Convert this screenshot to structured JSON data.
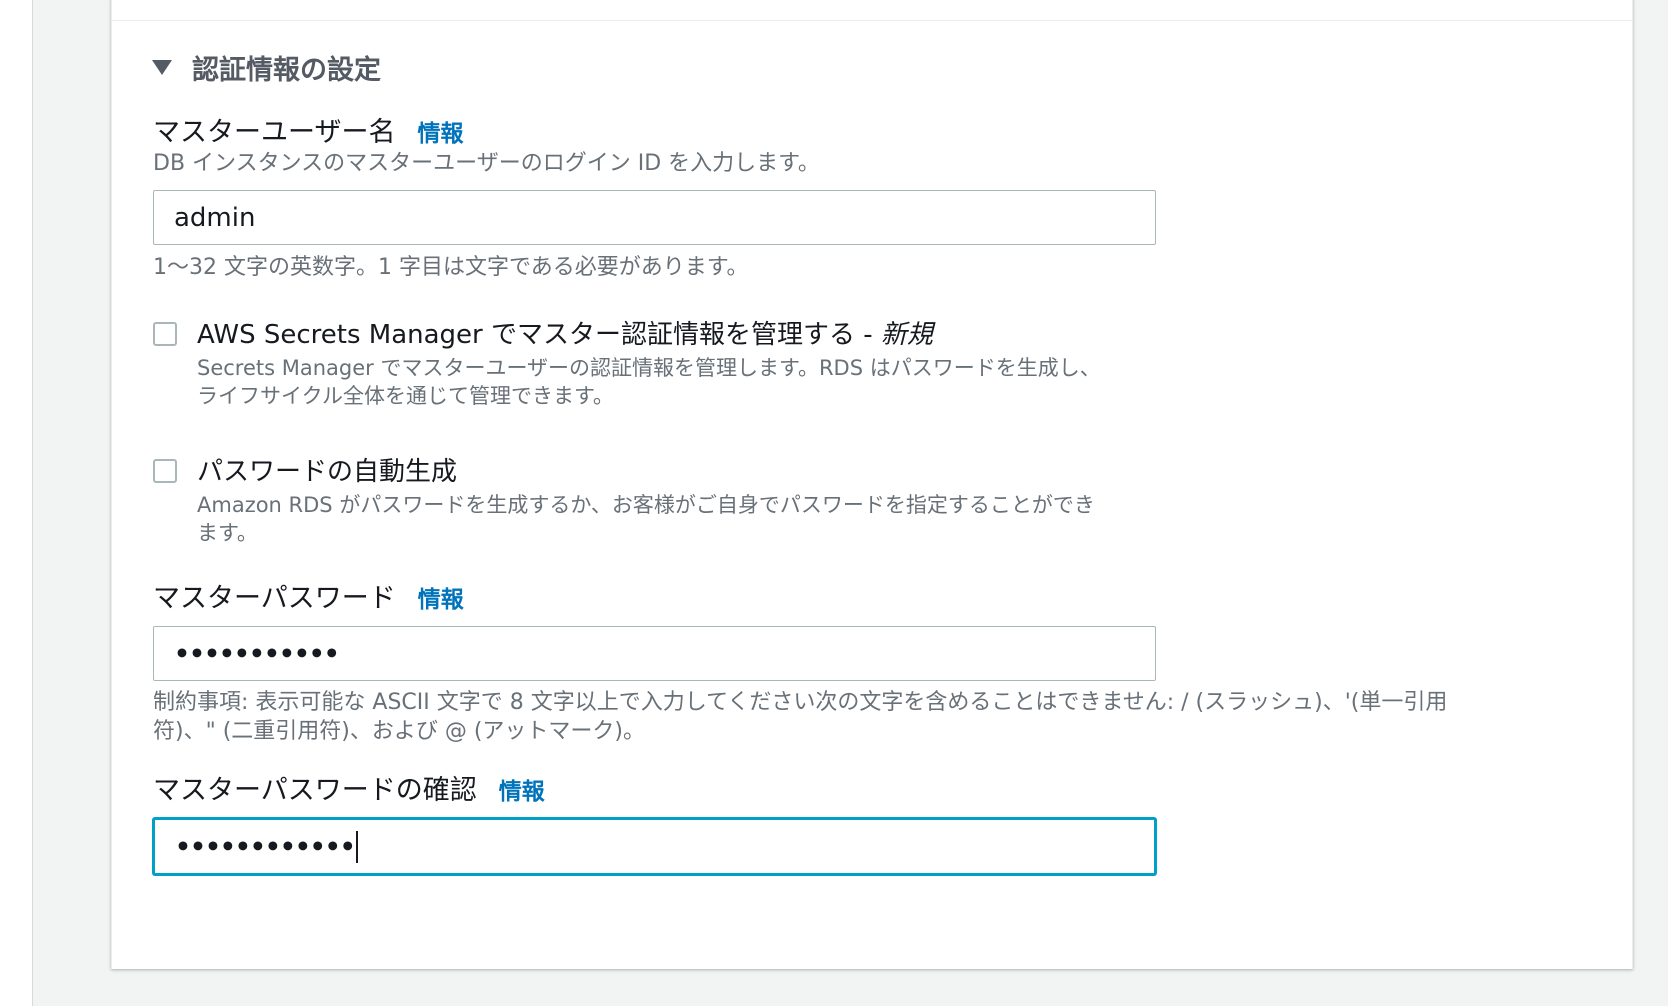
{
  "credentials_section": {
    "title": "認証情報の設定"
  },
  "master_username": {
    "label": "マスターユーザー名",
    "info_link": "情報",
    "description": "DB インスタンスのマスターユーザーのログイン ID を入力します。",
    "value": "admin",
    "constraint": "1〜32 文字の英数字。1 字目は文字である必要があります。"
  },
  "secrets_manager_option": {
    "label": "AWS Secrets Manager でマスター認証情報を管理する - ",
    "label_new": "新規",
    "description_line1": "Secrets Manager でマスターユーザーの認証情報を管理します。RDS はパスワードを生成し、",
    "description_line2": "ライフサイクル全体を通じて管理できます。",
    "checked": false
  },
  "auto_generate_password": {
    "label": "パスワードの自動生成",
    "description_line1": "Amazon RDS がパスワードを生成するか、お客様がご自身でパスワードを指定することができ",
    "description_line2": "ます。",
    "checked": false
  },
  "master_password": {
    "label": "マスターパスワード",
    "info_link": "情報",
    "masked_value": "•••••••••••",
    "constraint_line1": "制約事項: 表示可能な ASCII 文字で 8 文字以上で入力してください次の文字を含めることはできません: / (スラッシュ)、'(単一引用",
    "constraint_line2": "符)、\" (二重引用符)、および @ (アットマーク)。"
  },
  "confirm_password": {
    "label": "マスターパスワードの確認",
    "info_link": "情報",
    "masked_value": "••••••••••••"
  },
  "colors": {
    "link": "#0073bb",
    "focus": "#00a1c9",
    "muted_text": "#687078"
  },
  "icons": {
    "section_toggle": "caret-down-icon"
  }
}
